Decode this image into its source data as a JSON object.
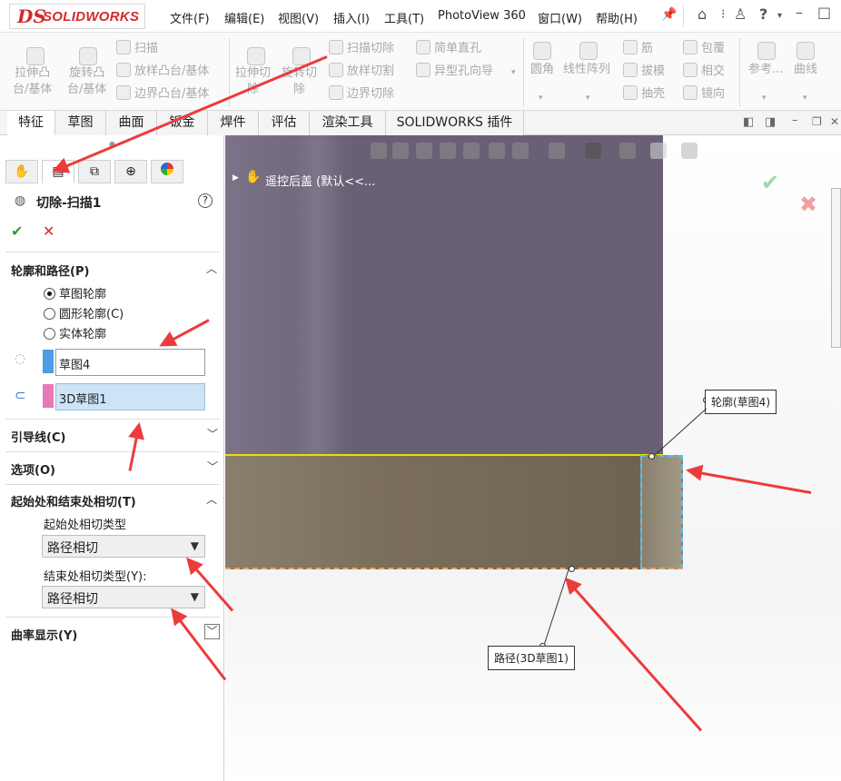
{
  "app": {
    "logo_ds": "DS",
    "logo_text": "SOLIDWORKS"
  },
  "menu": {
    "items": [
      "文件(F)",
      "编辑(E)",
      "视图(V)",
      "插入(I)",
      "工具(T)",
      "PhotoView 360",
      "窗口(W)",
      "帮助(H)"
    ]
  },
  "command_manager": {
    "extrude_boss": "拉伸凸\n台/基体",
    "revolve_boss": "旋转凸\n台/基体",
    "sweep": "扫描",
    "loft_boss": "放样凸台/基体",
    "boundary_boss": "边界凸台/基体",
    "extrude_cut": "拉伸切\n除",
    "revolve_cut": "旋转切\n除",
    "sweep_cut": "扫描切除",
    "loft_cut": "放样切割",
    "boundary_cut": "边界切除",
    "simple_hole": "简单直孔",
    "hole_wizard": "异型孔向导",
    "fillet": "圆角",
    "linear_pattern": "线性阵列",
    "rib": "筋",
    "draft": "拔模",
    "shell": "抽壳",
    "wrap": "包覆",
    "intersect": "相交",
    "mirror": "镜向",
    "reference": "参考...",
    "curves": "曲线"
  },
  "tabs": [
    "特征",
    "草图",
    "曲面",
    "钣金",
    "焊件",
    "评估",
    "渲染工具",
    "SOLIDWORKS 插件"
  ],
  "active_tab": 0,
  "property_manager": {
    "title": "切除-扫描1",
    "sections": {
      "profile_path": {
        "header": "轮廓和路径(P)",
        "options": [
          "草图轮廓",
          "圆形轮廓(C)",
          "实体轮廓"
        ],
        "selected_option": 0,
        "profile_value": "草图4",
        "path_value": "3D草图1",
        "profile_color": "#4a9de6",
        "path_color": "#e879b7"
      },
      "guide_curves": {
        "header": "引导线(C)"
      },
      "options": {
        "header": "选项(O)"
      },
      "tangency": {
        "header": "起始处和结束处相切(T)",
        "start_label": "起始处相切类型",
        "start_value": "路径相切",
        "end_label": "结束处相切类型(Y):",
        "end_value": "路径相切"
      },
      "curvature": {
        "header": "曲率显示(Y)"
      }
    }
  },
  "viewport": {
    "tree_item": "遥控后盖 (默认<<...",
    "callout_profile": "轮廓(草图4)",
    "callout_path": "路径(3D草图1)"
  },
  "colors": {
    "accent_red": "#ec3b3b",
    "ok_green": "#2f9e3a",
    "cancel_red": "#d42a2a",
    "profile_highlight": "#cde4f7"
  }
}
